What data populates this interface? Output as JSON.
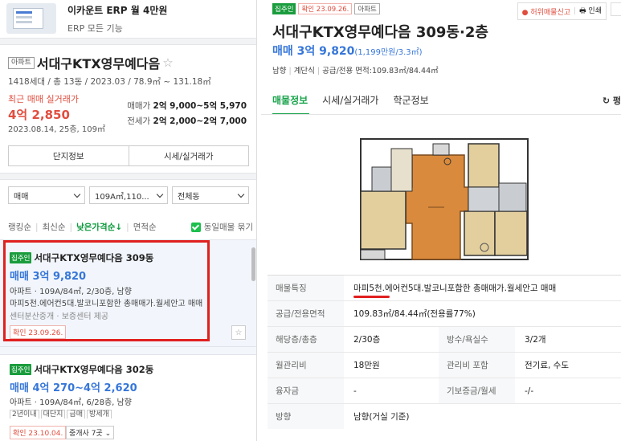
{
  "ad": {
    "title": "이카운트 ERP 월 4만원",
    "subtitle": "ERP 모든 기능"
  },
  "complex": {
    "tag": "아파트",
    "name": "서대구KTX영무예다음",
    "star": "☆",
    "meta": "1418세대 / 총 13동 / 2023.03 / 78.9㎡ ~ 131.18㎡",
    "recent_label": "최근 매매 실거래가",
    "recent_price": "4억 2,850",
    "recent_date": "2023.08.14, 25층, 109㎡",
    "sale_range_label": "매매가",
    "sale_range_value": "2억 9,000~5억 5,970",
    "jeonse_range_label": "전세가",
    "jeonse_range_value": "2억 2,000~2억 7,000",
    "btn_info": "단지정보",
    "btn_trade": "시세/실거래가"
  },
  "filters": {
    "deal_type": "매매",
    "area": "109A㎡,110...",
    "building": "전체동"
  },
  "sort": {
    "ranking": "랭킹순",
    "latest": "최신순",
    "low_price": "낮은가격순↓",
    "area": "면적순",
    "same_group": "동일매물 묶기"
  },
  "listings": [
    {
      "badge": "집주인",
      "name": "서대구KTX영무예다음 309동",
      "price": "매매 3억 9,820",
      "spec": "아파트 · 109A/84㎡, 2/30층, 남향",
      "desc": "마피5천.에어컨5대.발코니포함한 총매매가.월세안고 매매",
      "desc2": "센터분산중개 · 보증센터 제공",
      "confirm": "확인 23.09.26."
    },
    {
      "badge": "집주인",
      "name": "서대구KTX영무예다음 302동",
      "price": "매매 4억 270~4억 2,620",
      "spec": "아파트 · 109A/84㎡, 6/28층, 남향",
      "tags": [
        "2년이내",
        "대단지",
        "급매",
        "방세개"
      ],
      "confirm": "확인 23.10.04.",
      "agents": "중개사 7곳 ⌄"
    }
  ],
  "detail": {
    "badge_owner": "집주인",
    "badge_confirm": "확인 23.09.26.",
    "badge_type": "아파트",
    "report": "● 허위매물신고",
    "print": "🖶 인쇄",
    "title": "서대구KTX영무예다음 309동·2층",
    "price": "매매 3억 9,820",
    "price_sub": "(1,199만원/3.3㎡)",
    "summary": [
      "남향",
      "계단식",
      "공급/전용 면적:109.83㎡/84.44㎡"
    ],
    "tabs": [
      "매물정보",
      "시세/실거래가",
      "학군정보"
    ],
    "refresh": "↻ 펑"
  },
  "specs": {
    "feature_label": "매물특징",
    "feature_value": "마피5천.에어컨5대.발코니포함한 총매매가.월세안고 매매",
    "area_label": "공급/전용면적",
    "area_value": "109.83㎡/84.44㎡(전용률77%)",
    "floor_label": "해당층/총층",
    "floor_value": "2/30층",
    "rooms_label": "방수/욕실수",
    "rooms_value": "3/2개",
    "mgmt_label": "월관리비",
    "mgmt_value": "18만원",
    "mgmt_incl_label": "관리비 포함",
    "mgmt_incl_value": "전기료, 수도",
    "loan_label": "융자금",
    "loan_value": "-",
    "deposit_label": "기보증금/월세",
    "deposit_value": "-/-",
    "dir_label": "방향",
    "dir_value": "남향(거실 기준)"
  },
  "colors": {
    "accent_green": "#1a9c3d",
    "price_blue": "#3676d9",
    "alert_red": "#e04e3f"
  }
}
